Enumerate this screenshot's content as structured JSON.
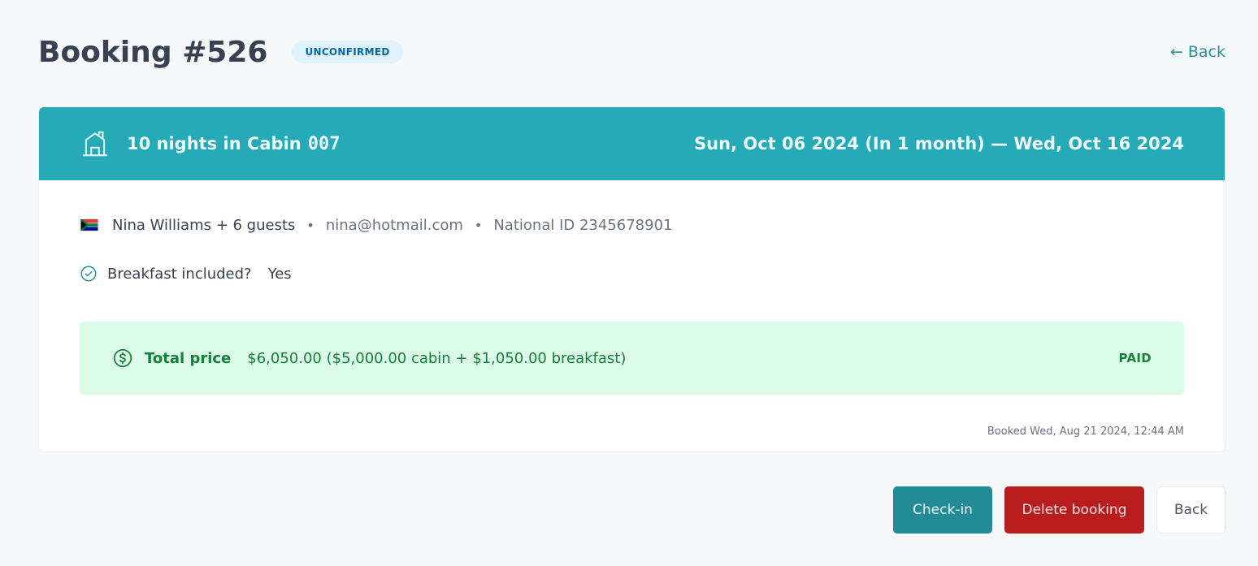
{
  "header": {
    "title": "Booking #526",
    "status": "UNCONFIRMED",
    "back_link": "← Back"
  },
  "booking": {
    "nights_text": "10 nights in Cabin",
    "cabin_code": "007",
    "dates": "Sun, Oct 06 2024 (In 1 month) — Wed, Oct 16 2024",
    "guest": {
      "name": "Nina Williams + 6 guests",
      "email": "nina@hotmail.com",
      "national_id": "National ID 2345678901",
      "flag": "south-africa-flag"
    },
    "breakfast": {
      "label": "Breakfast included?",
      "value": "Yes"
    },
    "price": {
      "label": "Total price",
      "value": "$6,050.00 ($5,000.00 cabin + $1,050.00 breakfast)",
      "status": "PAID"
    },
    "booked_at": "Booked Wed, Aug 21 2024, 12:44 AM"
  },
  "actions": {
    "checkin": "Check-in",
    "delete": "Delete booking",
    "back": "Back"
  },
  "colors": {
    "brand": "#27aab8",
    "paid_bg": "#dcfce7",
    "paid_text": "#15803d",
    "danger": "#b91c1c",
    "unconfirmed_bg": "#e0f2fe"
  },
  "icons": [
    "cabin-icon",
    "check-circle-icon",
    "dollar-circle-icon",
    "flag-icon"
  ]
}
